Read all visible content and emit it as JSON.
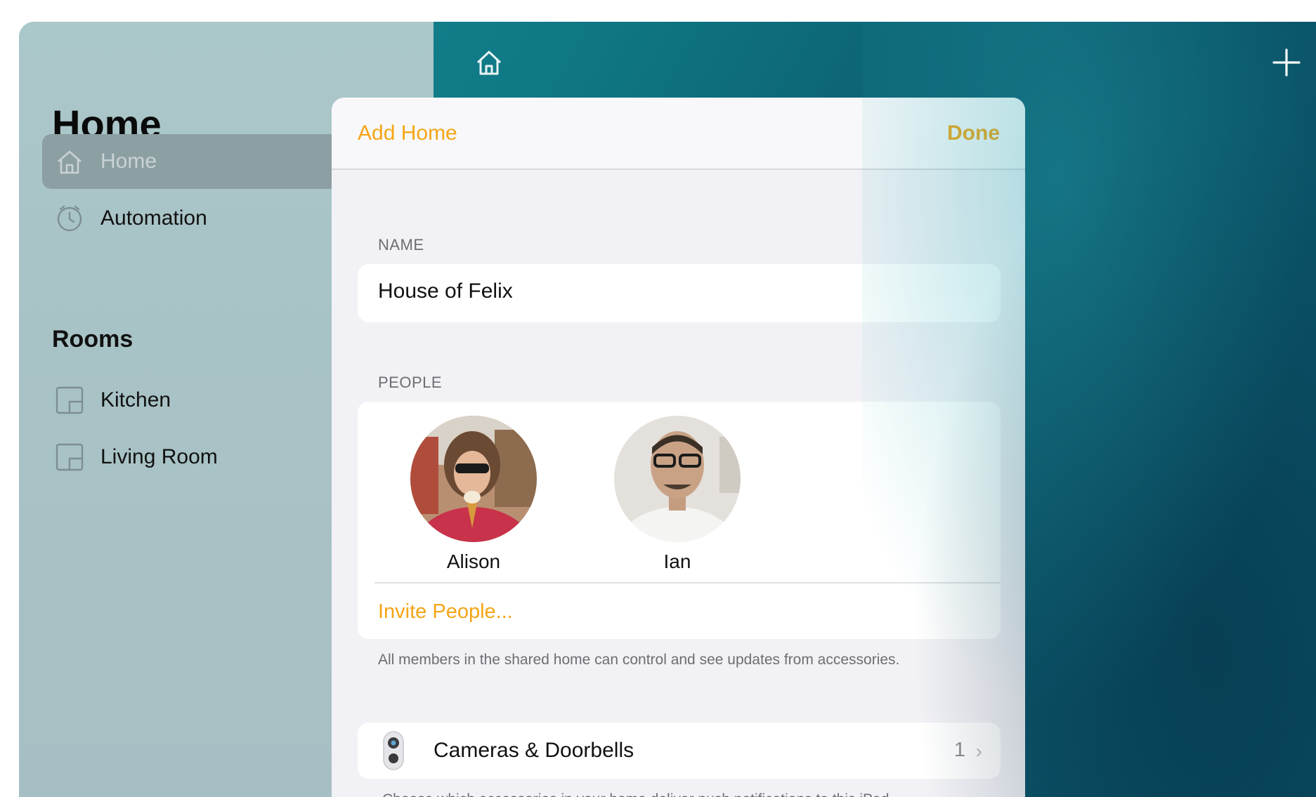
{
  "sidebar": {
    "title": "Home",
    "items": [
      {
        "label": "Home",
        "icon": "house-icon",
        "selected": true
      },
      {
        "label": "Automation",
        "icon": "clock-icon",
        "selected": false
      }
    ],
    "rooms_header": "Rooms",
    "rooms": [
      {
        "label": "Kitchen",
        "icon": "room-icon"
      },
      {
        "label": "Living Room",
        "icon": "room-icon"
      }
    ]
  },
  "toolbar": {
    "home_icon": "house-icon",
    "add_icon": "plus-icon"
  },
  "sheet": {
    "title": "Add Home",
    "done_label": "Done",
    "name_section": {
      "label": "NAME",
      "value": "House of Felix"
    },
    "people_section": {
      "label": "PEOPLE",
      "people": [
        {
          "name": "Alison"
        },
        {
          "name": "Ian"
        }
      ],
      "invite_label": "Invite People...",
      "footnote": "All members in the shared home can control and see updates from accessories."
    },
    "cameras_row": {
      "label": "Cameras & Doorbells",
      "count": "1",
      "icon": "camera-icon",
      "footnote": "Choose which accessories in your home deliver push notifications to this iPad."
    }
  },
  "colors": {
    "accent": "#f4a516",
    "sidebar_bg": "#aac7c9",
    "content_bg": "#0f7582"
  }
}
